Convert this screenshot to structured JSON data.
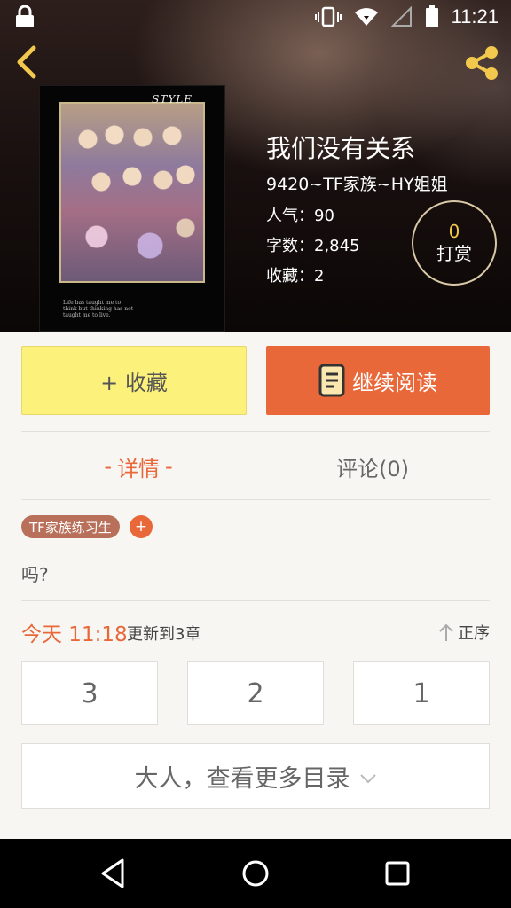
{
  "status_bar": {
    "time": "11:21"
  },
  "book": {
    "title": "我们没有关系",
    "author": "9420~TF家族~HY姐姐",
    "popularity": "人气：90",
    "word_count": "字数：2,845",
    "favorites": "收藏：2",
    "cover_style_text": "STYLE",
    "cover_caption": "Life has taught me to think but thinking has not taught me to live."
  },
  "tip": {
    "count": "0",
    "label": "打赏"
  },
  "actions": {
    "collect_label": "+ 收藏",
    "read_label": "继续阅读"
  },
  "tabs": {
    "details": "详情",
    "comments": "评论(0)"
  },
  "tags": [
    {
      "label": "TF家族练习生"
    }
  ],
  "tag_add": "+",
  "description": "吗?",
  "update": {
    "time": "今天 11:18",
    "text": "更新到3章",
    "sort_label": "正序"
  },
  "chapters": [
    "3",
    "2",
    "1"
  ],
  "more_catalog": "大人，查看更多目录",
  "colors": {
    "accent": "#e8683a",
    "collect_bg": "#fcf17a",
    "tag_bg": "#b8705a",
    "tip_count": "#f2c94c"
  }
}
